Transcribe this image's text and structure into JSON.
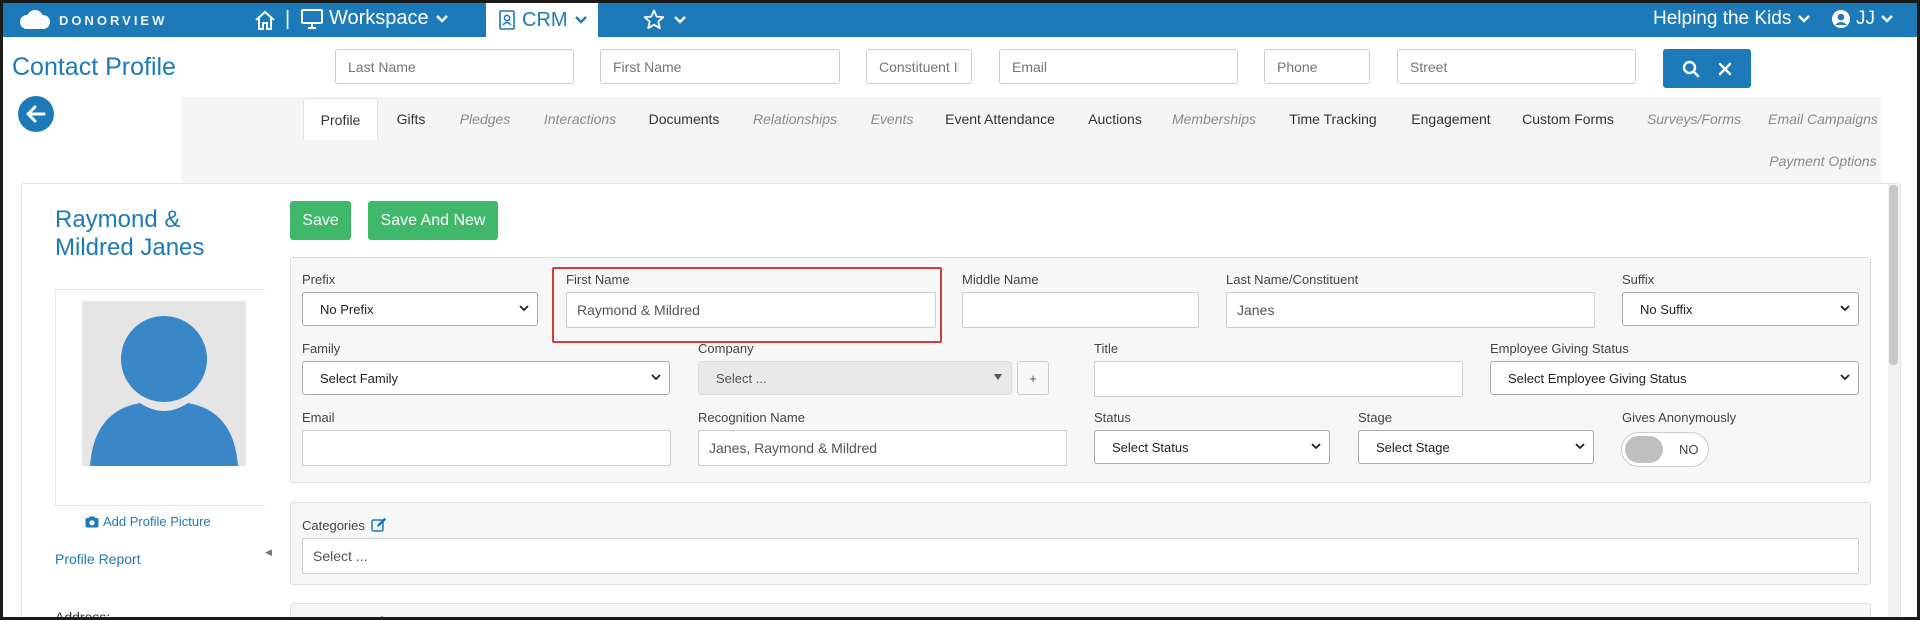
{
  "topbar": {
    "brand": "DONORVIEW",
    "workspace_label": "Workspace",
    "crm_label": "CRM",
    "org_name": "Helping the Kids",
    "user_initials": "JJ",
    "separator": "|"
  },
  "page": {
    "title": "Contact Profile"
  },
  "search": {
    "last_name_placeholder": "Last Name",
    "first_name_placeholder": "First Name",
    "constituent_placeholder": "Constituent ID",
    "email_placeholder": "Email",
    "phone_placeholder": "Phone",
    "street_placeholder": "Street"
  },
  "tabs": [
    {
      "label": "Profile",
      "state": "active"
    },
    {
      "label": "Gifts",
      "state": "enabled"
    },
    {
      "label": "Pledges",
      "state": "disabled"
    },
    {
      "label": "Interactions",
      "state": "disabled"
    },
    {
      "label": "Documents",
      "state": "enabled"
    },
    {
      "label": "Relationships",
      "state": "disabled"
    },
    {
      "label": "Events",
      "state": "disabled"
    },
    {
      "label": "Event Attendance",
      "state": "enabled"
    },
    {
      "label": "Auctions",
      "state": "enabled"
    },
    {
      "label": "Memberships",
      "state": "disabled"
    },
    {
      "label": "Time Tracking",
      "state": "enabled"
    },
    {
      "label": "Engagement",
      "state": "enabled"
    },
    {
      "label": "Custom Forms",
      "state": "enabled"
    },
    {
      "label": "Surveys/Forms",
      "state": "disabled"
    },
    {
      "label": "Email Campaigns",
      "state": "disabled"
    },
    {
      "label": "Payment Options",
      "state": "disabled"
    }
  ],
  "sidebar": {
    "contact_name_line1": "Raymond &",
    "contact_name_line2": "Mildred Janes",
    "add_picture_label": "Add Profile Picture",
    "profile_report_label": "Profile Report",
    "address_label": "Address:"
  },
  "actions": {
    "save_label": "Save",
    "save_and_new_label": "Save And New"
  },
  "form": {
    "prefix": {
      "label": "Prefix",
      "value": "No Prefix"
    },
    "first_name": {
      "label": "First Name",
      "value": "Raymond & Mildred"
    },
    "middle_name": {
      "label": "Middle Name",
      "value": ""
    },
    "last_name": {
      "label": "Last Name/Constituent",
      "value": "Janes"
    },
    "suffix": {
      "label": "Suffix",
      "value": "No Suffix"
    },
    "family": {
      "label": "Family",
      "value": "Select Family"
    },
    "company": {
      "label": "Company",
      "value": "Select ...",
      "add_label": "+"
    },
    "title": {
      "label": "Title",
      "value": ""
    },
    "employee_giving": {
      "label": "Employee Giving Status",
      "value": "Select Employee Giving Status"
    },
    "email": {
      "label": "Email",
      "value": ""
    },
    "recognition_name": {
      "label": "Recognition Name",
      "value": "Janes, Raymond & Mildred"
    },
    "status": {
      "label": "Status",
      "value": "Select Status"
    },
    "stage": {
      "label": "Stage",
      "value": "Select Stage"
    },
    "gives_anonymously": {
      "label": "Gives Anonymously",
      "value": "NO"
    }
  },
  "categories": {
    "label": "Categories",
    "placeholder": "Select ..."
  },
  "colors": {
    "brand_blue": "#1c7ab8",
    "save_green": "#3fb86a",
    "highlight_red": "#d33a3a"
  }
}
